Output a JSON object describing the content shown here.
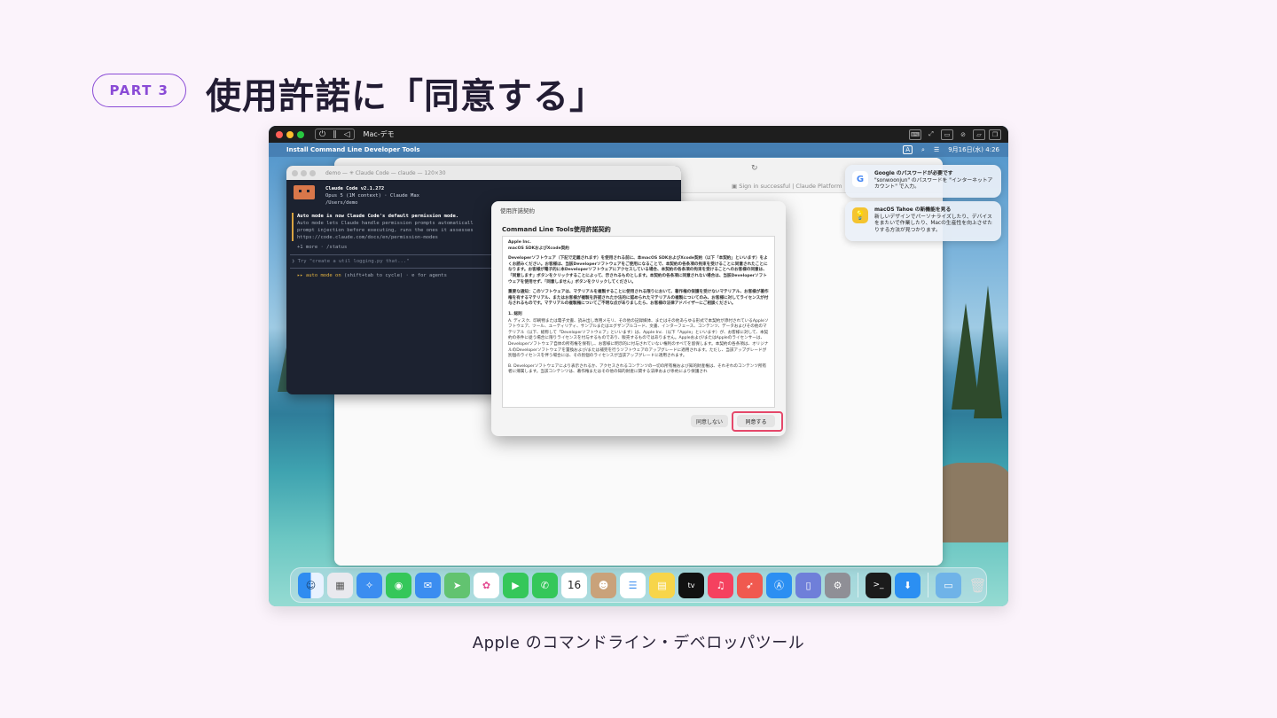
{
  "slide": {
    "part_label": "PART 3",
    "title": "使用許諾に「同意する」",
    "caption": "Apple のコマンドライン・デベロッパツール"
  },
  "vm_toolbar": {
    "window_title": "Mac-デモ"
  },
  "menubar": {
    "app_name": "Install Command Line Developer Tools",
    "input_indicator": "A",
    "datetime": "9月16日(水) 4:26"
  },
  "browser": {
    "tab_title": "Sign in successful | Claude Platform"
  },
  "terminal": {
    "title": "demo — ✳ Claude Code — claude — 120×30",
    "app_line": "Claude Code v2.1.272",
    "model_line": "Opus 5 (1M context) · Claude Max",
    "path_line": "/Users/demo",
    "notice_title": "Auto mode is now Claude Code's default permission mode.",
    "notice_lines": [
      "Auto mode lets Claude handle permission prompts automaticall",
      "prompt injection before executing, runs the ones it assesses",
      "https://code.claude.com/docs/en/permission-modes"
    ],
    "more_line": "+1 more · /status",
    "prompt_placeholder": "Try \"create a util logging.py that...\"",
    "mode_prefix": "▸▸ auto mode on",
    "mode_suffix": " (shift+tab to cycle) · ⊘ for agents"
  },
  "dialog": {
    "window_title": "使用許諾契約",
    "heading": "Command Line Tools使用許諾契約",
    "text": {
      "company": "Apple Inc.",
      "product": "macOS SDKおよびXcode契約",
      "para1": "Developerソフトウェア（下記で定義されます）を使用される前に、本macOS SDKおよびXcode契約（以下「本契約」といいます）をよくお読みください。お客様は、当該Developerソフトウェアをご使用になることで、本契約の各条項の拘束を受けることに同意されたことになります。お客様が電子的に本Developerソフトウェアにアクセスしている場合、本契約の各条項の拘束を受けることへのお客様の同意は、「同意します」ボタンをクリックすることによって、示されるものとします。本契約の各条項に同意されない場合は、当該Developerソフトウェアを使用せず、「同意しません」ボタンをクリックしてください。",
      "para2": "重要な通知：このソフトウェアは、マテリアルを複製することに使用される限りにおいて、著作権の保護を受けないマテリアル、お客様が著作権を有するマテリアル、またはお客様が複製を許諾されたか法的に認められたマテリアルの複製についてのみ、お客様に対してライセンスが付与されるものです。マテリアルの複製権についてご不明な点がありましたら、お客様の法律アドバイザーにご相談ください。",
      "section1": "1. 総則",
      "para3": "A. ディスク、印刷物または電子文書、読み出し専用メモリ、その他の記録媒体、またはその他あらゆる形式で本契約が添付されているAppleソフトウェア、ツール、ユーティリティ、サンプルまたはエグザンプルコード、文書、インターフェース、コンテンツ、データおよびその他のマテリアル（以下、総称して「Developerソフトウェア」といいます）は、Apple Inc.（以下「Apple」といいます）が、お客様に対して、本契約の条件に従う場合に限りライセンスを付与するものであり、販売するものではありません。Appleおよび/またはAppleのライセンサーは、Developerソフトウェア自体の所有権を保有し、お客様に明示的に付与されていない権利のすべてを留保します。本契約の各条項は、オリジナルのDeveloperソフトウェアを置換および/または補完を行うソフトウェアのアップグレードに適用されます。ただし、当該アップグレードが別個のライセンスを伴う場合には、その別個のライセンスが当該アップグレードに適用されます。",
      "para4": "B. Developerソフトウェアにより表示されるか、アクセスされるコンテンツの一切の所有権および知的財産権は、それぞれのコンテンツ所有者に帰属します。当該コンテンツは、著作権またはその他の知的財産に関する法律および条約により保護され"
    },
    "decline_label": "同意しない",
    "agree_label": "同意する"
  },
  "notifications": [
    {
      "icon": "google-icon",
      "title": "Google のパスワードが必要です",
      "body": "\"sonwoonjun\" のパスワードを \"インターネットアカウント\" で入力。"
    },
    {
      "icon": "tips-icon",
      "title": "macOS Tahoe の新機能を見る",
      "body": "新しいデザインでパーソナライズしたり、デバイスをまたいで作業したり、Macの生産性を向上させたりする方法が見つかります。"
    }
  ],
  "dock": {
    "calendar_day": "16",
    "tv_label": "tv",
    "apps": [
      "finder-icon",
      "launchpad-icon",
      "safari-icon",
      "messages-icon",
      "mail-icon",
      "maps-icon",
      "photos-icon",
      "facetime-icon",
      "phone-icon",
      "calendar-icon",
      "contacts-icon",
      "reminders-icon",
      "notes-icon",
      "tv-icon",
      "music-icon",
      "rocket-icon",
      "app-store-icon",
      "preview-icon",
      "settings-icon",
      "terminal-icon",
      "downloads-icon",
      "folder-icon",
      "trash-icon"
    ]
  },
  "colors": {
    "accent_purple": "#8a4bd6",
    "highlight_red": "#e5486a",
    "background": "#fbf3fb"
  }
}
